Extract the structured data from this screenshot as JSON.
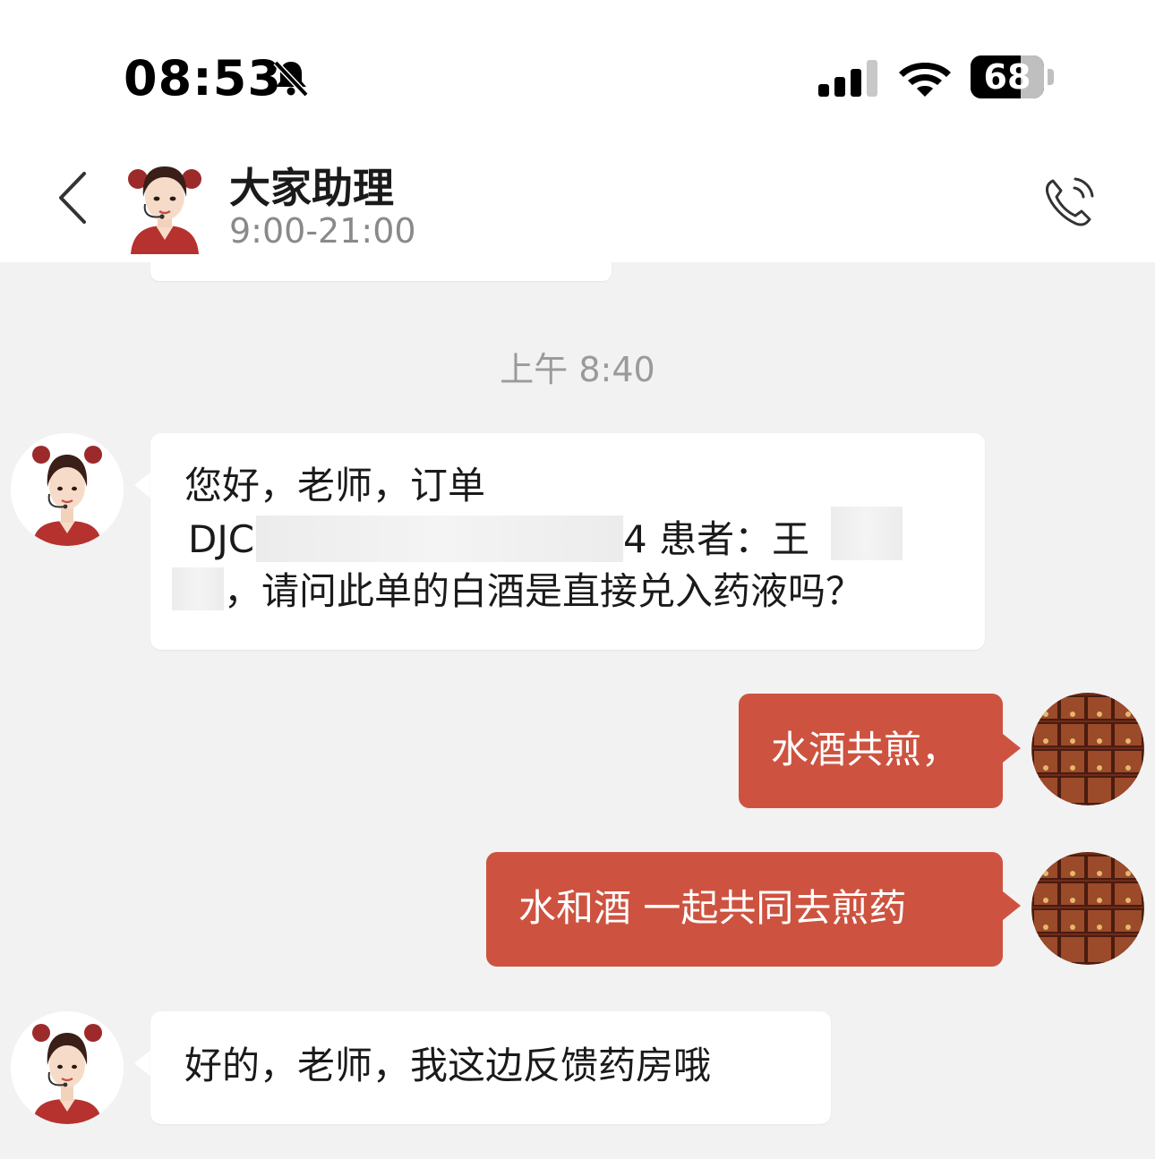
{
  "status_bar": {
    "time": "08:53",
    "battery_percent": "68",
    "battery_level": 0.68,
    "icons": [
      "bell-muted-icon",
      "cellular-signal-icon",
      "wifi-icon",
      "battery-icon"
    ]
  },
  "header": {
    "title": "大家助理",
    "subtitle": "9:00-21:00",
    "icons": [
      "back-chevron-icon",
      "agent-avatar",
      "phone-call-icon"
    ]
  },
  "chat": {
    "timestamp": "上午 8:40",
    "messages": [
      {
        "side": "incoming",
        "lines": [
          "您好，老师，订单",
          "DJC",
          "4 患者：王",
          "，请问此单的白酒是直接兑入药液吗？"
        ]
      },
      {
        "side": "outgoing",
        "text": "水酒共煎，"
      },
      {
        "side": "outgoing",
        "text": "水和酒 一起共同去煎药"
      },
      {
        "side": "incoming",
        "text": "好的，老师，我这边反馈药房哦"
      }
    ]
  },
  "colors": {
    "accent": "#cd5340",
    "background": "#f2f2f2",
    "bubble_incoming": "#ffffff",
    "timestamp_text": "#9a9a9a"
  }
}
